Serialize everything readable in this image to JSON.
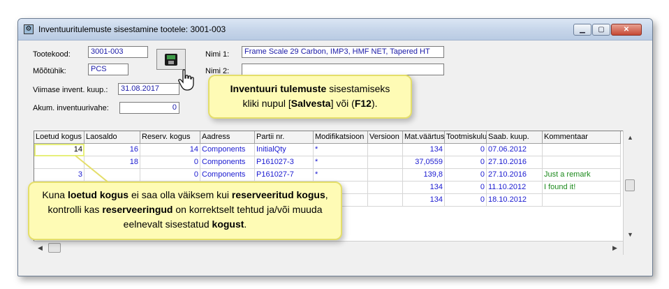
{
  "window": {
    "title": "Inventuuritulemuste sisestamine tootele: 3001-003"
  },
  "form": {
    "tootekood_label": "Tootekood:",
    "tootekood_value": "3001-003",
    "mootuhik_label": "Mõõtühik:",
    "mootuhik_value": "PCS",
    "viimase_label": "Viimase invent. kuup.:",
    "viimase_value": "31.08.2017",
    "akum_label": "Akum. inventuurivahe:",
    "akum_value": "0",
    "nimi1_label": "Nimi 1:",
    "nimi1_value": "Frame Scale 29 Carbon, IMP3, HMF NET, Tapered HT",
    "nimi2_label": "Nimi 2:",
    "nimi2_value": ""
  },
  "grid": {
    "columns": [
      "Loetud kogus",
      "Laosaldo",
      "Reserv. kogus",
      "Aadress",
      "Partii nr.",
      "Modifikatsioon",
      "Versioon",
      "Mat.väärtus",
      "Tootmiskulu",
      "Saab. kuup.",
      "Kommentaar"
    ],
    "rows": [
      [
        "14",
        "16",
        "14",
        "Components",
        "InitialQty",
        "*",
        "",
        "134",
        "0",
        "07.06.2012",
        ""
      ],
      [
        "",
        "18",
        "0",
        "Components",
        "P161027-3",
        "*",
        "",
        "37,0559",
        "0",
        "27.10.2016",
        ""
      ],
      [
        "3",
        "",
        "0",
        "Components",
        "P161027-7",
        "*",
        "",
        "139,8",
        "0",
        "27.10.2016",
        "Just a remark"
      ],
      [
        "",
        "",
        "",
        "",
        "",
        "",
        "",
        "134",
        "0",
        "11.10.2012",
        "I found it!"
      ],
      [
        "",
        "",
        "",
        "",
        "",
        "",
        "",
        "134",
        "0",
        "18.10.2012",
        ""
      ]
    ]
  },
  "callout_top": {
    "line1_bold": "Inventuuri tulemuste",
    "line1_rest": " sisestamiseks",
    "line2_a": "kliki nupul [",
    "line2_bold1": "Salvesta",
    "line2_b": "] või (",
    "line2_bold2": "F12",
    "line2_c": ")."
  },
  "callout_bottom": {
    "p1": "Kuna ",
    "b1": "loetud kogus",
    "p2": " ei saa olla väiksem kui ",
    "b2": "reserveeritud kogus",
    "p3": ", kontrolli kas ",
    "b3": "reserveeringud",
    "p4": " on korrektselt tehtud ja/või muuda eelnevalt sisestatud ",
    "b4": "kogust",
    "p5": "."
  },
  "icons": {
    "save": "floppy-disk-icon",
    "pointer": "hand-pointer-icon",
    "app": "app-settings-icon"
  }
}
